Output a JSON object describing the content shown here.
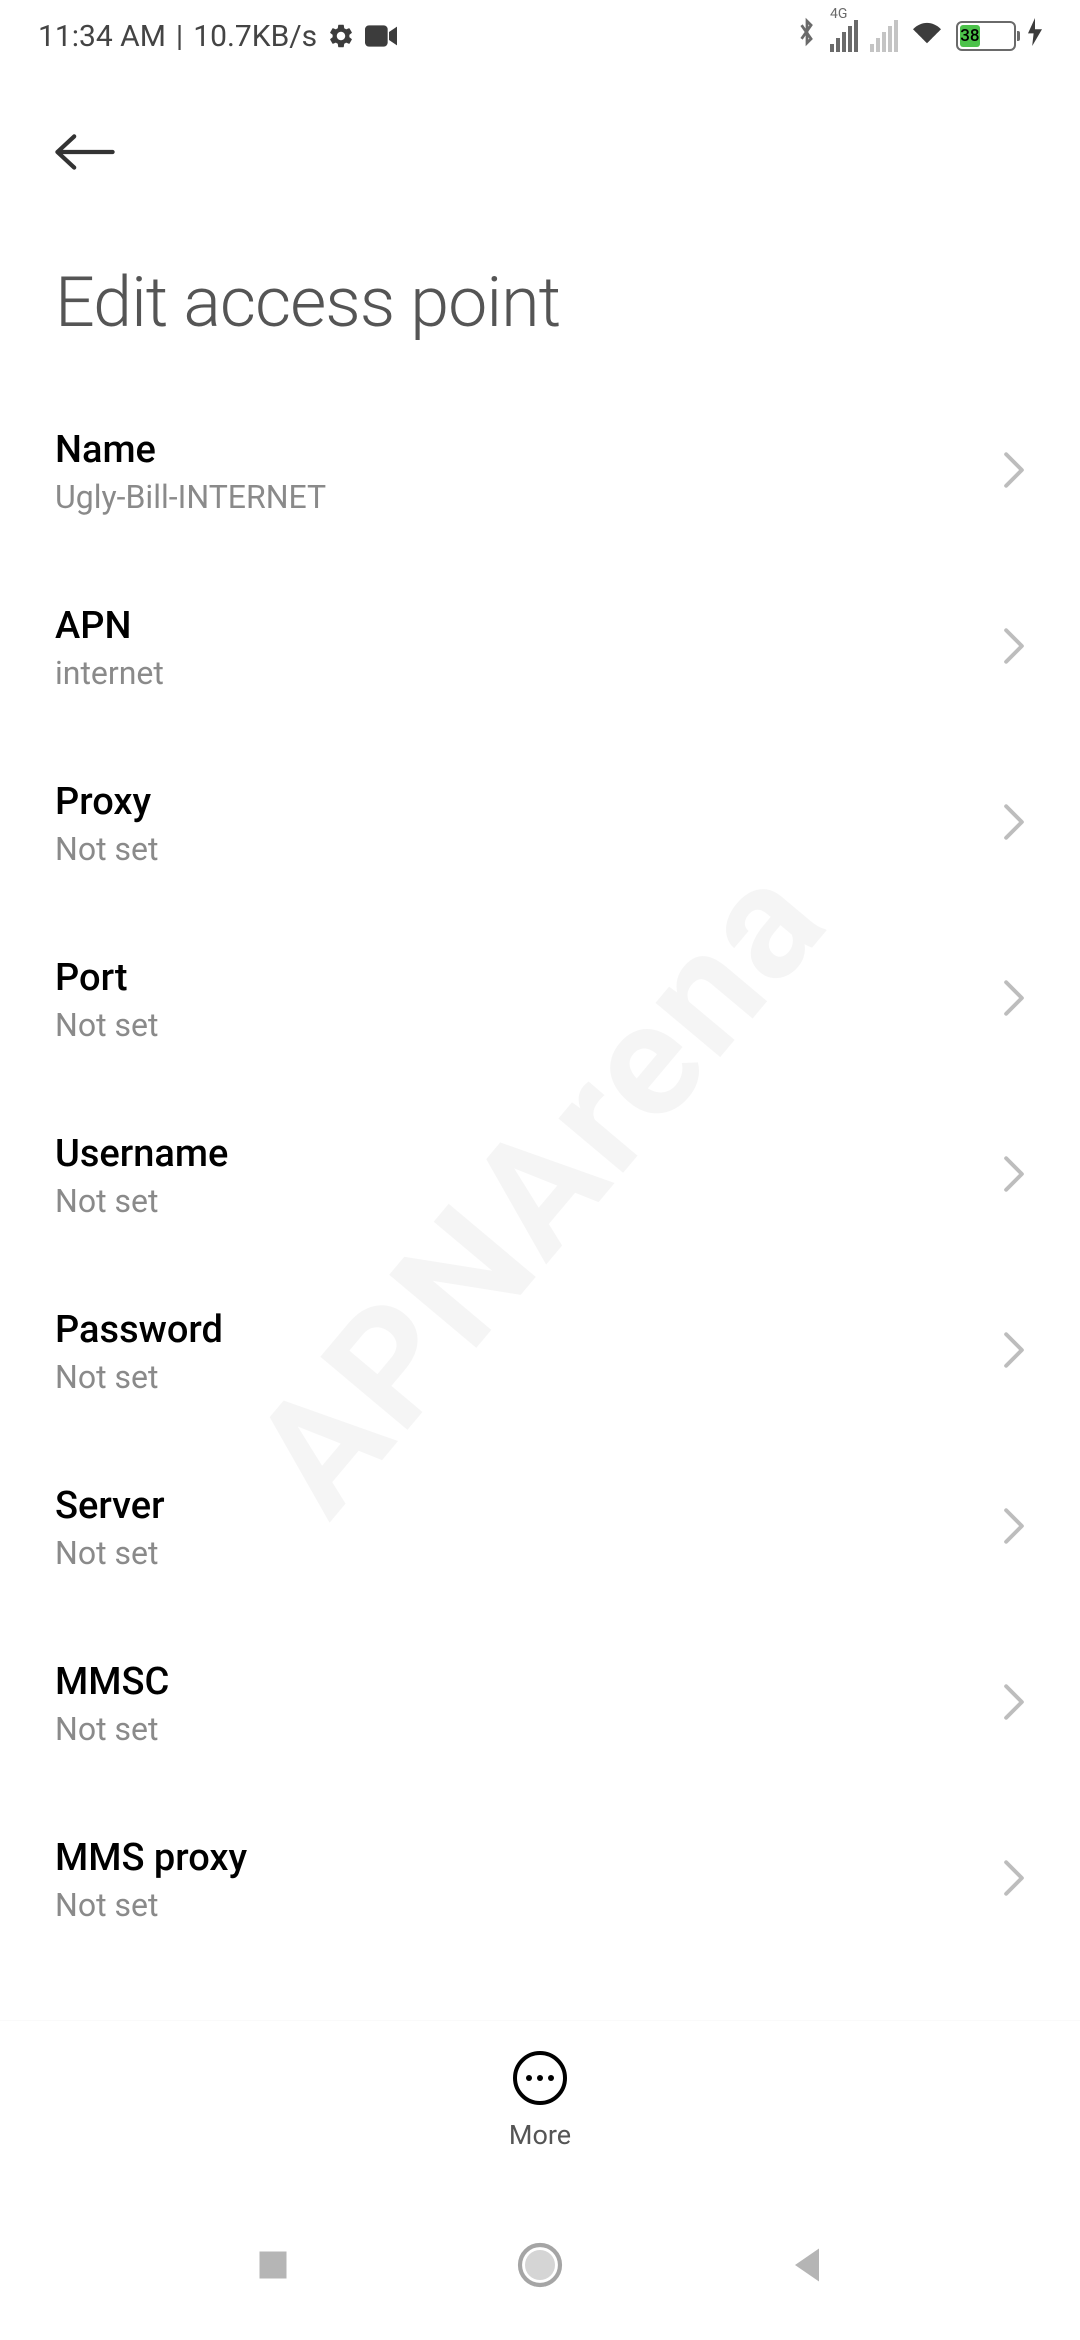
{
  "status": {
    "time": "11:34 AM",
    "speed": "10.7KB/s",
    "battery_pct": 38,
    "battery_label": "38"
  },
  "header": {
    "title": "Edit access point"
  },
  "items": [
    {
      "label": "Name",
      "value": "Ugly-Bill-INTERNET"
    },
    {
      "label": "APN",
      "value": "internet"
    },
    {
      "label": "Proxy",
      "value": "Not set"
    },
    {
      "label": "Port",
      "value": "Not set"
    },
    {
      "label": "Username",
      "value": "Not set"
    },
    {
      "label": "Password",
      "value": "Not set"
    },
    {
      "label": "Server",
      "value": "Not set"
    },
    {
      "label": "MMSC",
      "value": "Not set"
    },
    {
      "label": "MMS proxy",
      "value": "Not set"
    }
  ],
  "bottom": {
    "more_label": "More"
  },
  "watermark": "APNArena"
}
